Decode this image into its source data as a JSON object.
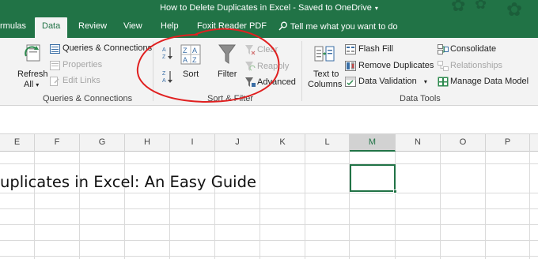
{
  "window": {
    "title": "How to Delete Duplicates in Excel  -  Saved to OneDrive",
    "title_caret": "▾"
  },
  "tabs": [
    {
      "label": "rmulas",
      "active": false
    },
    {
      "label": "Data",
      "active": true
    },
    {
      "label": "Review",
      "active": false
    },
    {
      "label": "View",
      "active": false
    },
    {
      "label": "Help",
      "active": false
    },
    {
      "label": "Foxit Reader PDF",
      "active": false
    }
  ],
  "tell_me": "Tell me what you want to do",
  "ribbon": {
    "queries": {
      "refresh_label": "Refresh",
      "refresh_sub": "All",
      "refresh_caret": "▾",
      "queries_connections": "Queries & Connections",
      "properties": "Properties",
      "edit_links": "Edit Links",
      "group_label": "Queries & Connections"
    },
    "sort_filter": {
      "sort": "Sort",
      "filter": "Filter",
      "clear": "Clear",
      "reapply": "Reapply",
      "advanced": "Advanced",
      "group_label": "Sort & Filter",
      "sort_az_letters": "AZ",
      "sort_za_letters": "ZA"
    },
    "data_tools": {
      "text_to_columns_1": "Text to",
      "text_to_columns_2": "Columns",
      "flash_fill": "Flash Fill",
      "remove_duplicates": "Remove Duplicates",
      "data_validation": "Data Validation",
      "data_validation_caret": "▾",
      "consolidate": "Consolidate",
      "relationships": "Relationships",
      "manage_data_model": "Manage Data Model",
      "group_label": "Data Tools"
    }
  },
  "grid": {
    "columns": [
      "E",
      "F",
      "G",
      "H",
      "I",
      "J",
      "K",
      "L",
      "M",
      "N",
      "O",
      "P"
    ],
    "selected_column": "M",
    "cell_text": "uplicates in Excel: An Easy Guide"
  },
  "colors": {
    "excel_green": "#217346",
    "annotation_red": "#e02020"
  }
}
